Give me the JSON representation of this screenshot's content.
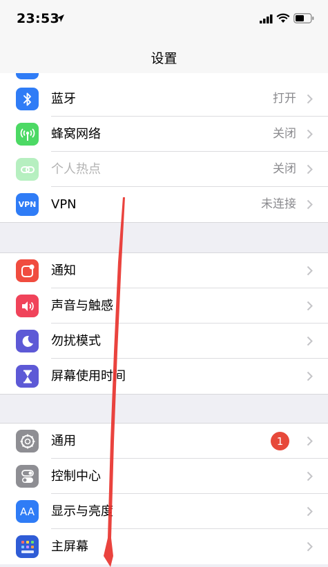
{
  "status_bar": {
    "time": "23:53",
    "icons": [
      "location-arrow-icon",
      "cellular-signal-icon",
      "wifi-icon",
      "battery-icon"
    ]
  },
  "nav": {
    "title": "设置"
  },
  "groups": [
    {
      "rows": [
        {
          "label": "蓝牙",
          "value": "打开",
          "icon": "bluetooth-icon",
          "color": "#2f7cf6"
        },
        {
          "label": "蜂窝网络",
          "value": "关闭",
          "icon": "antenna-icon",
          "color": "#4cd964"
        },
        {
          "label": "个人热点",
          "value": "关闭",
          "icon": "hotspot-icon",
          "color": "#4cd964"
        },
        {
          "label": "VPN",
          "value": "未连接",
          "icon_text": "VPN",
          "icon": "vpn-icon",
          "color": "#2f7cf6"
        }
      ]
    },
    {
      "rows": [
        {
          "label": "通知",
          "icon": "notifications-icon",
          "color": "#f04c3f"
        },
        {
          "label": "声音与触感",
          "icon": "speaker-icon",
          "color": "#f0435a"
        },
        {
          "label": "勿扰模式",
          "icon": "moon-icon",
          "color": "#5d59d6"
        },
        {
          "label": "屏幕使用时间",
          "icon": "hourglass-icon",
          "color": "#5d59d6"
        }
      ]
    },
    {
      "rows": [
        {
          "label": "通用",
          "badge": "1",
          "icon": "gear-icon",
          "color": "#8e8e93"
        },
        {
          "label": "控制中心",
          "icon": "toggles-icon",
          "color": "#8e8e93"
        },
        {
          "label": "显示与亮度",
          "icon_text": "AA",
          "icon": "display-icon",
          "color": "#2f7cf6"
        },
        {
          "label": "主屏幕",
          "icon": "home-screen-icon",
          "color": "#2f5cd6"
        }
      ]
    }
  ],
  "colors": {
    "accent_arrow": "#e8332e",
    "badge": "#e7493a"
  }
}
